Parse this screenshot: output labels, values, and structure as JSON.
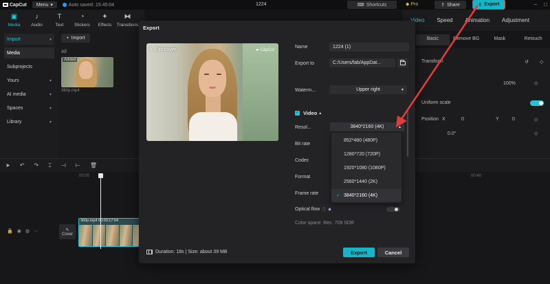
{
  "topbar": {
    "app_name": "CapCut",
    "menu_label": "Menu",
    "autosave_text": "Auto saved: 15:45:04",
    "project_title": "1224",
    "shortcuts_label": "Shortcuts",
    "pro_label": "Pro",
    "share_label": "Share",
    "export_label": "Export"
  },
  "toolbar": {
    "items": [
      {
        "label": "Media",
        "icon": "media-icon"
      },
      {
        "label": "Audio",
        "icon": "audio-icon"
      },
      {
        "label": "Text",
        "icon": "text-icon"
      },
      {
        "label": "Stickers",
        "icon": "stickers-icon"
      },
      {
        "label": "Effects",
        "icon": "effects-icon"
      },
      {
        "label": "Transitions",
        "icon": "transitions-icon"
      }
    ]
  },
  "sidebar": {
    "import_label": "Import",
    "items": [
      "Media",
      "Subprojects",
      "Yours",
      "AI media",
      "Spaces",
      "Library"
    ]
  },
  "media": {
    "import_button": "Import",
    "all_label": "All",
    "thumb_tag": "Added",
    "thumb_name": "360p.mp4"
  },
  "right_panel": {
    "tabs": [
      "Video",
      "Speed",
      "Animation",
      "Adjustment"
    ],
    "subtabs": [
      "Basic",
      "Remove BG",
      "Mask",
      "Retouch"
    ],
    "transform_label": "Transform",
    "scale_value": "100%",
    "uniform_scale_label": "Uniform scale",
    "position_label": "Position",
    "x_label": "X",
    "x_value": "0",
    "y_label": "Y",
    "y_value": "0",
    "rotate_value": "0.0°"
  },
  "timeline": {
    "ruler_start": "00:00",
    "ruler_end": "00:40",
    "clip_label": "360p.mp4  00:00:17:04",
    "cover_label": "Cover"
  },
  "export_dialog": {
    "title": "Export",
    "edit_cover_label": "Edit cover",
    "watermark_text": "CapCut",
    "name_label": "Name",
    "name_value": "1224 (1)",
    "export_to_label": "Export to",
    "export_to_value": "C:/Users/fab/AppDat...",
    "watermark_label": "Waterm...",
    "watermark_value": "Upper right",
    "video_section_label": "Video",
    "resolution_label": "Resol...",
    "resolution_value": "3840*2160 (4K)",
    "bitrate_label": "Bit rate",
    "codec_label": "Codec",
    "format_label": "Format",
    "framerate_label": "Frame rate",
    "optical_flow_label": "Optical flow",
    "color_space_text": "Color space: Rec. 709 SDR",
    "resolution_options": [
      "852*480 (480P)",
      "1280*720 (720P)",
      "1920*1080 (1080P)",
      "2560*1440 (2K)",
      "3840*2160 (4K)"
    ],
    "selected_option_index": 4,
    "footer_info": "Duration: 18s | Size: about 39 MB",
    "export_button": "Export",
    "cancel_button": "Cancel"
  },
  "colors": {
    "accent": "#16b5c7",
    "annotation_arrow": "#e23b3b"
  }
}
